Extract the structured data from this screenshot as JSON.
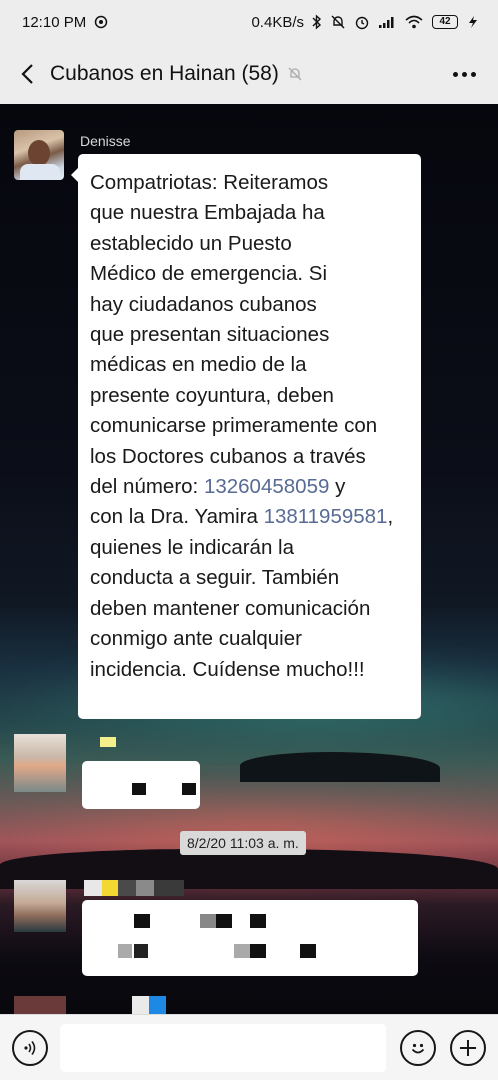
{
  "status_bar": {
    "time": "12:10 PM",
    "network_speed": "0.4KB/s",
    "battery_level": "42",
    "icons": [
      "notification-dot-icon",
      "bluetooth-icon",
      "mute-bell-icon",
      "alarm-icon",
      "signal-icon",
      "wifi-icon",
      "battery-icon",
      "charging-icon"
    ]
  },
  "header": {
    "back_icon": "chevron-left-icon",
    "title": "Cubanos en Hainan (58)",
    "mute_icon": "muted-bell-icon",
    "more_icon": "more-dots-icon"
  },
  "messages": [
    {
      "sender": "Denisse",
      "text_parts": {
        "part1": "Compatriotas: Reiteramos\nque nuestra Embajada ha\nestablecido un Puesto\nMédico de emergencia.  Si\nhay ciudadanos cubanos\nque presentan situaciones\nmédicas en medio de la\npresente coyuntura, deben\ncomunicarse primeramente con\nlos Doctores cubanos a través\ndel número: ",
        "phone1": "13260458059",
        "part2": " y\ncon la Dra. Yamira ",
        "phone2": "13811959581",
        "part3": ",\nquienes le indicarán la\nconducta a seguir.  También\ndeben mantener comunicación\nconmigo ante cualquier\nincidencia.  Cuídense mucho!!!"
      }
    }
  ],
  "timestamp": "8/2/20 11:03 a. m.",
  "input_bar": {
    "voice_icon": "voice-icon",
    "emoji_icon": "emoji-icon",
    "plus_icon": "plus-icon",
    "placeholder": ""
  },
  "colors": {
    "link": "#576b95",
    "bar_background": "#ededed",
    "bubble": "#ffffff"
  }
}
